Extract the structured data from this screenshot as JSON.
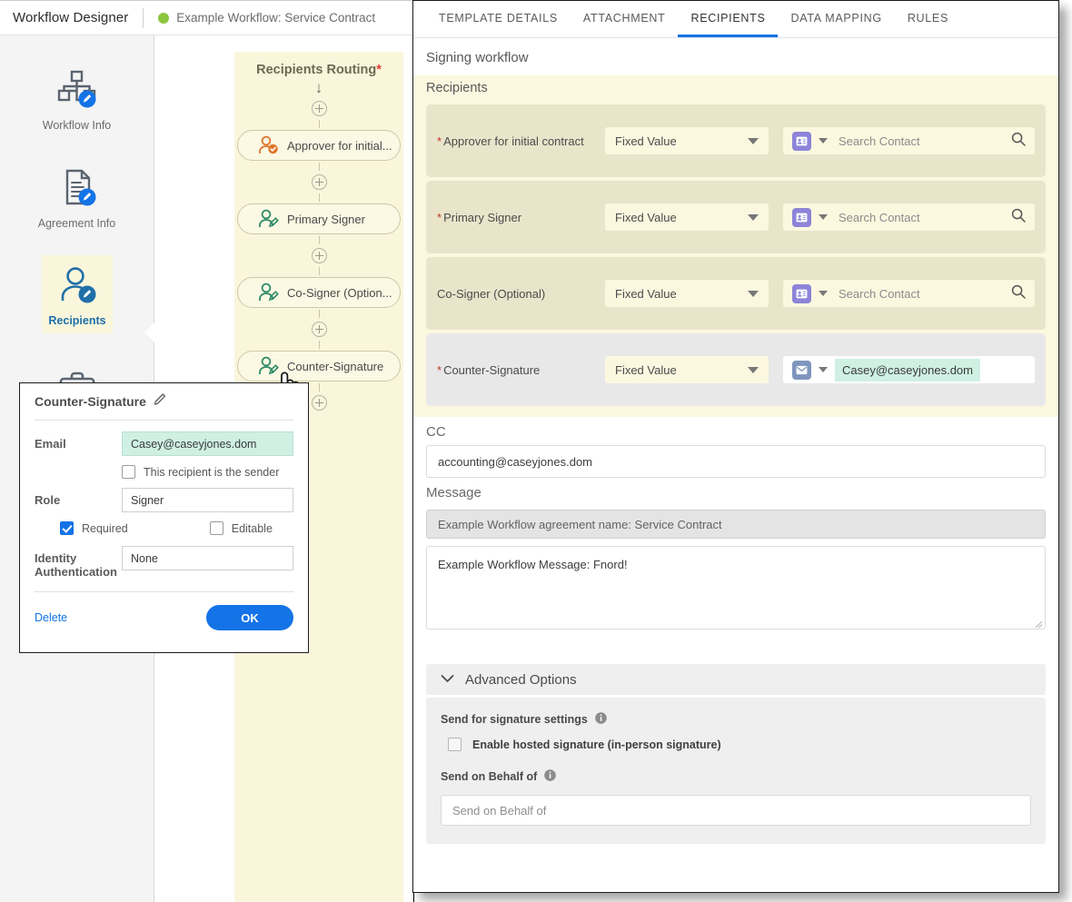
{
  "app": {
    "title": "Workflow Designer",
    "subtitle": "Example Workflow: Service Contract",
    "status_color": "#8CC63E"
  },
  "sidebar": {
    "items": [
      {
        "label": "Workflow Info",
        "icon": "org-chart-edit-icon",
        "active": false
      },
      {
        "label": "Agreement Info",
        "icon": "document-edit-icon",
        "active": false
      },
      {
        "label": "Recipients",
        "icon": "person-edit-icon",
        "active": true
      },
      {
        "label": "",
        "icon": "briefcase-icon",
        "active": false
      }
    ]
  },
  "flow": {
    "title": "Recipients Routing",
    "required_marker": "*",
    "nodes": [
      {
        "label": "Approver for initial...",
        "icon": "approver-icon",
        "color": "#E0762A"
      },
      {
        "label": "Primary Signer",
        "icon": "signer-icon",
        "color": "#2E8B67"
      },
      {
        "label": "Co-Signer (Option...",
        "icon": "signer-icon",
        "color": "#2E8B67"
      },
      {
        "label": "Counter-Signature",
        "icon": "signer-icon",
        "color": "#2E8B67"
      }
    ]
  },
  "popup": {
    "title": "Counter-Signature",
    "edit_icon": "pencil-icon",
    "email_label": "Email",
    "email_value": "Casey@caseyjones.dom",
    "sender_checkbox_label": "This recipient is the sender",
    "sender_checked": false,
    "role_label": "Role",
    "role_value": "Signer",
    "required_label": "Required",
    "required_checked": true,
    "editable_label": "Editable",
    "editable_checked": false,
    "identity_label": "Identity Authentication",
    "identity_value": "None",
    "delete_label": "Delete",
    "ok_label": "OK",
    "accent_color": "#1473E6"
  },
  "panel": {
    "tabs": [
      {
        "label": "TEMPLATE DETAILS",
        "active": false
      },
      {
        "label": "ATTACHMENT",
        "active": false
      },
      {
        "label": "RECIPIENTS",
        "active": true
      },
      {
        "label": "DATA MAPPING",
        "active": false
      },
      {
        "label": "RULES",
        "active": false
      }
    ],
    "signing_workflow_title": "Signing workflow",
    "recipients_heading": "Recipients",
    "recipient_rows": [
      {
        "label": "Approver for initial contract",
        "required": true,
        "select_value": "Fixed Value",
        "badge": "contact-card-icon",
        "contact_placeholder": "Search Contact",
        "contact_value": "",
        "has_search": true,
        "highlighted": false
      },
      {
        "label": "Primary Signer",
        "required": true,
        "select_value": "Fixed Value",
        "badge": "contact-card-icon",
        "contact_placeholder": "Search Contact",
        "contact_value": "",
        "has_search": true,
        "highlighted": false
      },
      {
        "label": "Co-Signer (Optional)",
        "required": false,
        "select_value": "Fixed Value",
        "badge": "contact-card-icon",
        "contact_placeholder": "Search Contact",
        "contact_value": "",
        "has_search": true,
        "highlighted": false
      },
      {
        "label": "Counter-Signature",
        "required": true,
        "select_value": "Fixed Value",
        "badge": "envelope-icon",
        "contact_placeholder": "",
        "contact_value": "Casey@caseyjones.dom",
        "has_search": false,
        "highlighted": true
      }
    ],
    "cc_label": "CC",
    "cc_value": "accounting@caseyjones.dom",
    "message_label": "Message",
    "subject_value": "Example Workflow agreement name: Service Contract",
    "message_value": "Example Workflow Message: Fnord!",
    "advanced_options_label": "Advanced Options",
    "send_signature_settings_label": "Send for signature settings",
    "hosted_signature_label": "Enable hosted signature (in-person signature)",
    "hosted_signature_checked": false,
    "send_on_behalf_label": "Send on Behalf of",
    "send_on_behalf_placeholder": "Send on Behalf of"
  }
}
